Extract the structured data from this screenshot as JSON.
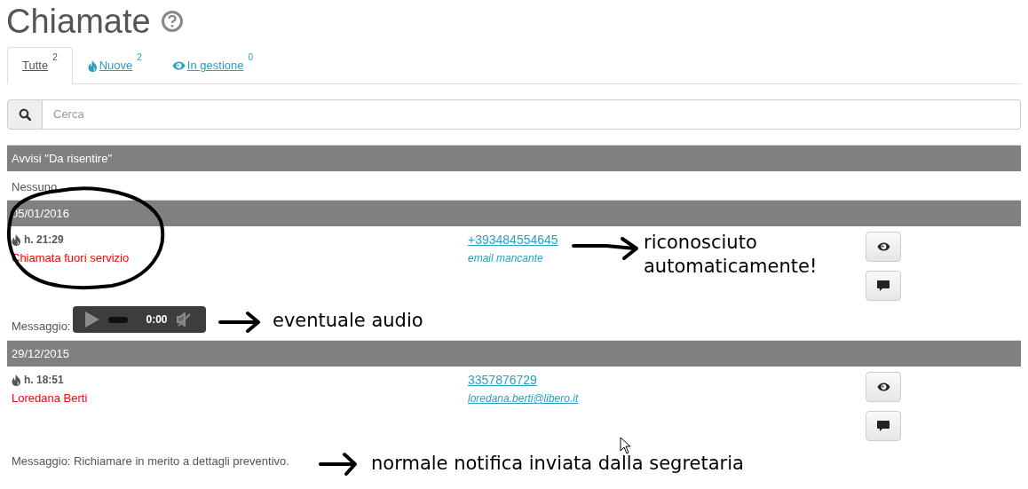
{
  "title": "Chiamate",
  "tabs": [
    {
      "label": "Tutte",
      "count": "2",
      "kind": "all",
      "selected": true
    },
    {
      "label": "Nuove",
      "count": "2",
      "kind": "new",
      "selected": false
    },
    {
      "label": "In gestione",
      "count": "0",
      "kind": "handling",
      "selected": false
    }
  ],
  "search": {
    "placeholder": "Cerca"
  },
  "alerts": {
    "title": "Avvisi \"Da risentire\"",
    "empty_text": "Nessuno"
  },
  "groups": [
    {
      "date": "05/01/2016",
      "calls": [
        {
          "new": true,
          "time": "h. 21:29",
          "caller": "Chiamata fuori servizio",
          "phone": "+393484554645",
          "email": {
            "text": "email mancante",
            "missing": true
          },
          "message": {
            "kind": "audio",
            "label": "Messaggio:",
            "time": "0:00"
          }
        }
      ]
    },
    {
      "date": "29/12/2015",
      "calls": [
        {
          "new": true,
          "time": "h. 18:51",
          "caller": "Loredana Berti",
          "phone": "3357876729",
          "email": {
            "text": "loredana.berti@libero.it",
            "missing": false
          },
          "message": {
            "kind": "text",
            "text": "Messaggio: Richiamare in merito a dettagli preventivo."
          }
        }
      ]
    }
  ],
  "annotations": [
    {
      "text": "riconosciuto automaticamente!"
    },
    {
      "text": "eventuale audio"
    },
    {
      "text": "normale notifica inviata dalla segretaria"
    }
  ]
}
